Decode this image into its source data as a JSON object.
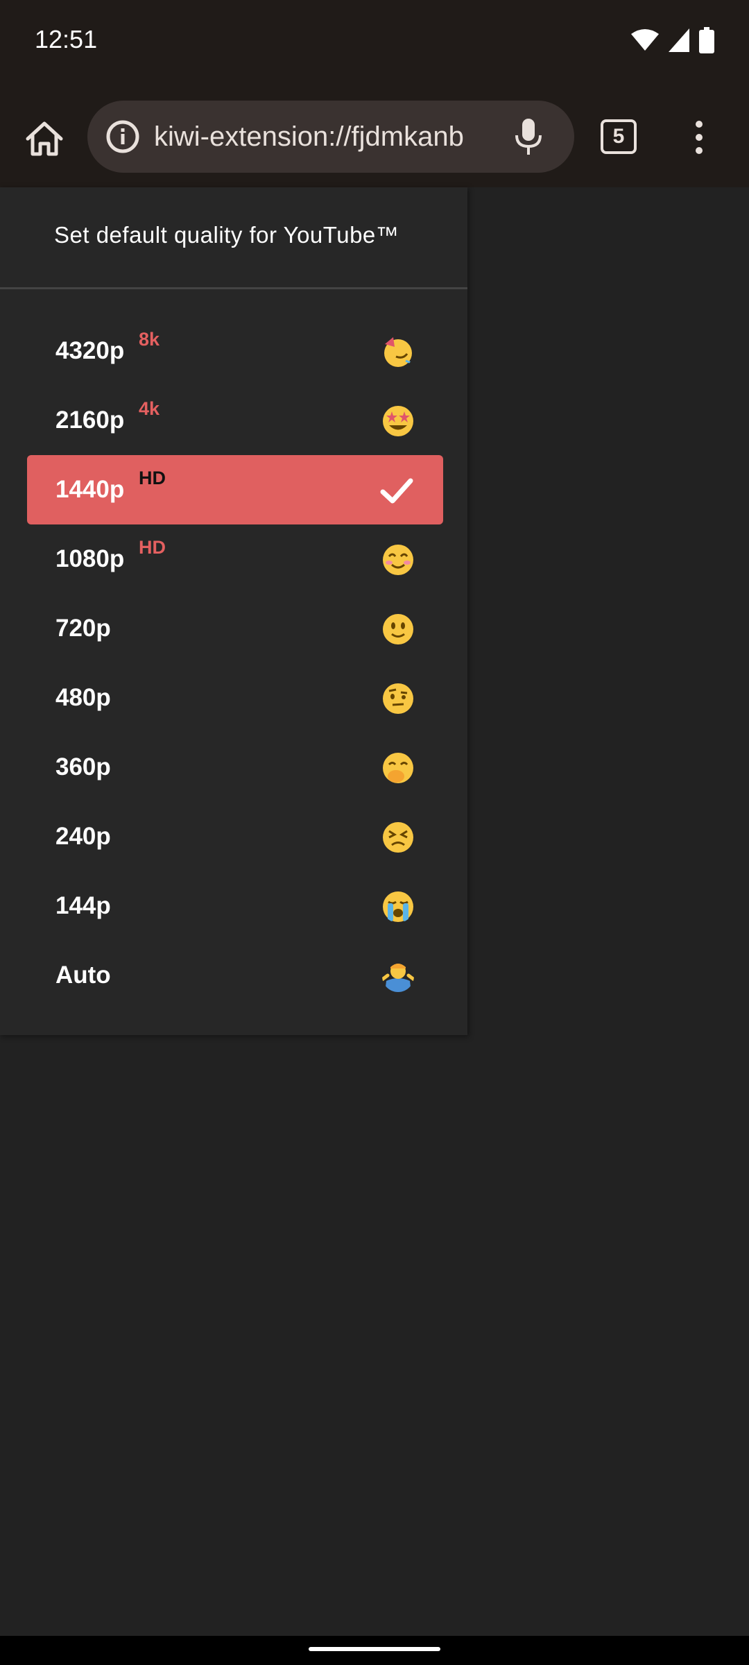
{
  "status_bar": {
    "time": "12:51",
    "icons": [
      "wifi-icon",
      "cell-signal-icon",
      "battery-icon"
    ]
  },
  "toolbar": {
    "url": "kiwi-extension://fjdmkanb",
    "tab_count": "5",
    "icons": [
      "home-icon",
      "info-icon",
      "mic-icon",
      "tabs-icon",
      "more-vert-icon"
    ]
  },
  "panel": {
    "title": "Set default quality for YouTube™",
    "items": [
      {
        "label": "4320p",
        "badge": "8k",
        "emoji": "partying-face-icon",
        "selected": false
      },
      {
        "label": "2160p",
        "badge": "4k",
        "emoji": "star-struck-icon",
        "selected": false
      },
      {
        "label": "1440p",
        "badge": "HD",
        "emoji": "check-icon",
        "selected": true
      },
      {
        "label": "1080p",
        "badge": "HD",
        "emoji": "smiling-face-icon",
        "selected": false
      },
      {
        "label": "720p",
        "badge": "",
        "emoji": "slightly-smiling-face-icon",
        "selected": false
      },
      {
        "label": "480p",
        "badge": "",
        "emoji": "raised-eyebrow-face-icon",
        "selected": false
      },
      {
        "label": "360p",
        "badge": "",
        "emoji": "hand-over-mouth-face-icon",
        "selected": false
      },
      {
        "label": "240p",
        "badge": "",
        "emoji": "persevering-face-icon",
        "selected": false
      },
      {
        "label": "144p",
        "badge": "",
        "emoji": "crying-face-icon",
        "selected": false
      },
      {
        "label": "Auto",
        "badge": "",
        "emoji": "person-shrugging-icon",
        "selected": false
      }
    ]
  },
  "colors": {
    "accent": "#e06060",
    "background": "#222222",
    "panel": "#272727",
    "toolbar": "#201b18",
    "url_bar": "#3a3230"
  }
}
